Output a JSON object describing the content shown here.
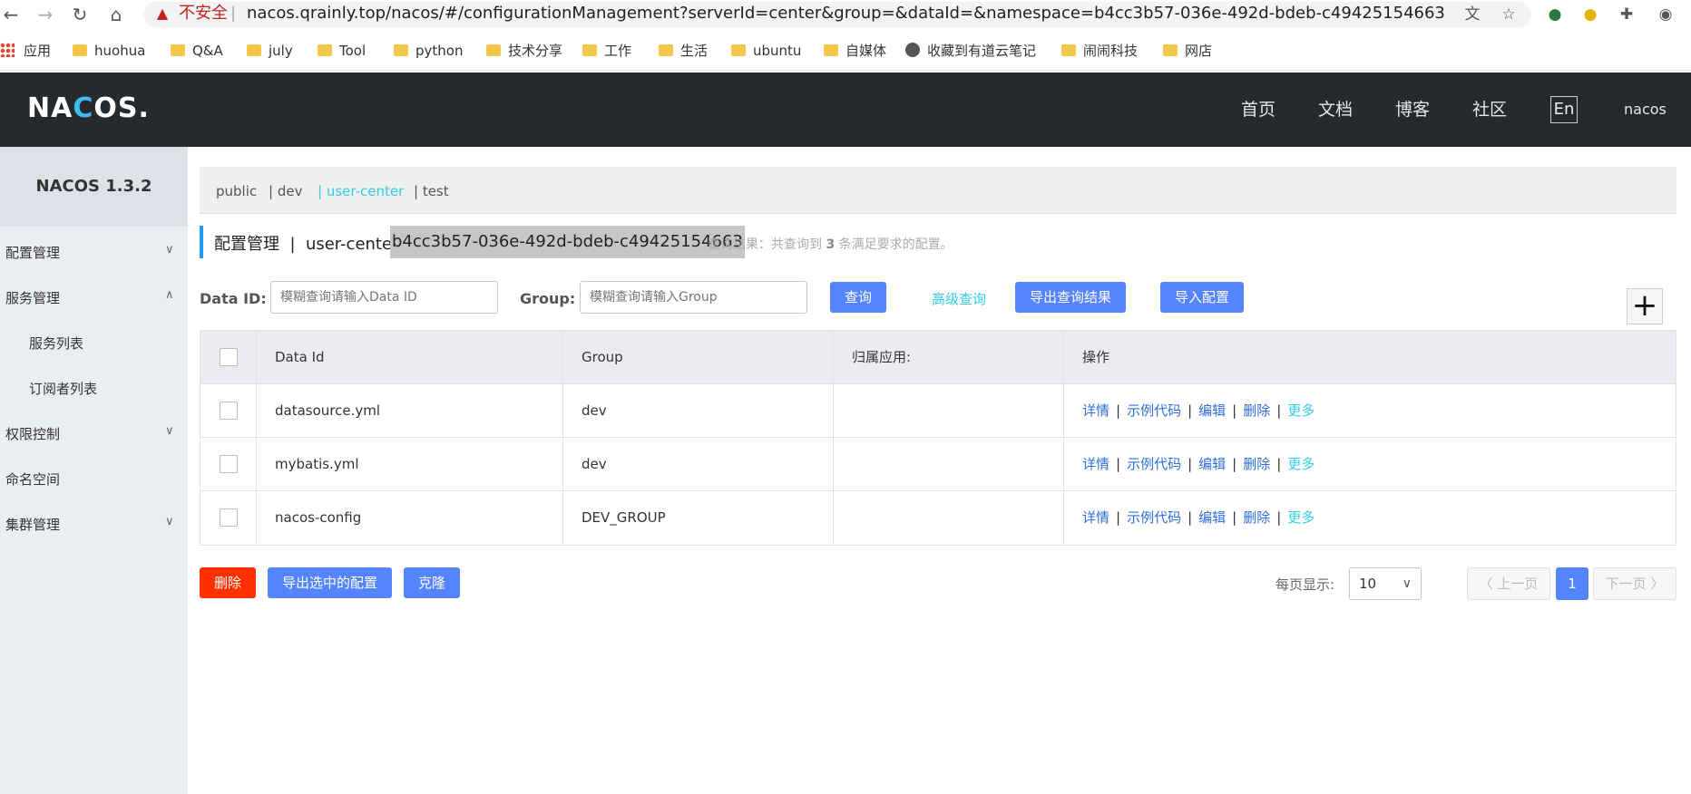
{
  "browser": {
    "insecure_label": "不安全",
    "url": "nacos.qrainly.top/nacos/#/configurationManagement?serverId=center&group=&dataId=&namespace=b4cc3b57-036e-492d-bdeb-c49425154663&pageSi...",
    "bookmarks": [
      "应用",
      "huohua",
      "Q&A",
      "july",
      "Tool",
      "python",
      "技术分享",
      "工作",
      "生活",
      "ubuntu",
      "自媒体",
      "收藏到有道云笔记",
      "闹闹科技",
      "网店"
    ]
  },
  "header": {
    "logo_pre": "NA",
    "logo_c": "C",
    "logo_post": "OS.",
    "nav": [
      "首页",
      "文档",
      "博客",
      "社区"
    ],
    "lang": "En",
    "user": "nacos"
  },
  "sidebar": {
    "version": "NACOS 1.3.2",
    "items": [
      "配置管理",
      "服务管理",
      "服务列表",
      "订阅者列表",
      "权限控制",
      "命名空间",
      "集群管理"
    ]
  },
  "namespaces": [
    "public",
    "| dev",
    "| user-center",
    "| test"
  ],
  "title": {
    "section": "配置管理  |  user-center",
    "namespace_id": "b4cc3b57-036e-492d-bdeb-c49425154663",
    "result_pre": "查询结果：共查询到",
    "result_count": "3",
    "result_post": "条满足要求的配置。"
  },
  "search": {
    "dataid_label": "Data ID:",
    "dataid_placeholder": "模糊查询请输入Data ID",
    "group_label": "Group:",
    "group_placeholder": "模糊查询请输入Group",
    "query_btn": "查询",
    "advanced": "高级查询",
    "export_results": "导出查询结果",
    "import_config": "导入配置",
    "plus": "+"
  },
  "table": {
    "headers": [
      "Data Id",
      "Group",
      "归属应用:",
      "操作"
    ],
    "rows": [
      {
        "data_id": "datasource.yml",
        "group": "dev",
        "app": ""
      },
      {
        "data_id": "mybatis.yml",
        "group": "dev",
        "app": ""
      },
      {
        "data_id": "nacos-config",
        "group": "DEV_GROUP",
        "app": ""
      }
    ],
    "ops": [
      "详情",
      "示例代码",
      "编辑",
      "删除",
      "更多"
    ],
    "op_sep": "|"
  },
  "footer": {
    "delete": "删除",
    "export_selected": "导出选中的配置",
    "clone": "克隆",
    "page_size_label": "每页显示:",
    "page_size": "10",
    "prev": "〈 上一页",
    "page": "1",
    "next": "下一页 〉"
  }
}
